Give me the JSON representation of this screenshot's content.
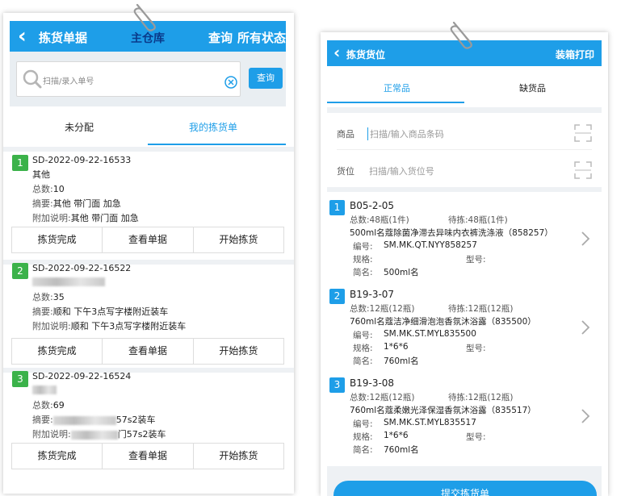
{
  "left": {
    "header": {
      "back": "‹",
      "title": "拣货单据",
      "warehouse": "主仓库",
      "query": "查询",
      "status": "所有状态"
    },
    "search": {
      "placeholder": "扫描/录入单号",
      "button": "查询"
    },
    "tabs": [
      {
        "label": "未分配"
      },
      {
        "label": "我的拣货单"
      }
    ],
    "cards": [
      {
        "index": "1",
        "code": "SD-2022-09-22-16533",
        "line2": "其他",
        "total_label": "总数:",
        "total": "10",
        "summary_label": "摘要:",
        "summary": "其他 带门面  加急",
        "note_label": "附加说明:",
        "note": "其他 带门面  加急",
        "buttons": [
          "拣货完成",
          "查看单据",
          "开始拣货"
        ]
      },
      {
        "index": "2",
        "code": "SD-2022-09-22-16522",
        "line2": "",
        "total_label": "总数:",
        "total": "35",
        "summary_label": "摘要:",
        "summary": "顺和 下午3点写字楼附近装车",
        "note_label": "附加说明:",
        "note": "顺和 下午3点写字楼附近装车",
        "buttons": [
          "拣货完成",
          "查看单据",
          "开始拣货"
        ]
      },
      {
        "index": "3",
        "code": "SD-2022-09-22-16524",
        "line2": "",
        "total_label": "总数:",
        "total": "69",
        "summary_label": "摘要:",
        "summary": "57s2装车",
        "note_label": "附加说明:",
        "note": "门57s2装车",
        "buttons": [
          "拣货完成",
          "查看单据",
          "开始拣货"
        ]
      }
    ]
  },
  "right": {
    "header": {
      "back": "‹",
      "title": "拣货货位",
      "print": "装箱打印"
    },
    "tabs": [
      {
        "label": "正常品"
      },
      {
        "label": "缺货品"
      }
    ],
    "fields": [
      {
        "label": "商品",
        "placeholder": "扫描/输入商品条码"
      },
      {
        "label": "货位",
        "placeholder": "扫描/输入货位号"
      }
    ],
    "items": [
      {
        "index": "1",
        "location": "B05-2-05",
        "total_label": "总数:",
        "total": "48瓶(1件)",
        "pending_label": "待拣:",
        "pending": "48瓶(1件)",
        "product": "500ml名蔻除菌净滞去异味内衣裤洗涤液（858257）",
        "code_label": "编号:",
        "code": "SM.MK.QT.NYY858257",
        "spec_label": "规格:",
        "spec": "",
        "model_label": "型号:",
        "model": "",
        "short_label": "简名:",
        "short": "500ml名"
      },
      {
        "index": "2",
        "location": "B19-3-07",
        "total_label": "总数:",
        "total": "12瓶(12瓶)",
        "pending_label": "待拣:",
        "pending": "12瓶(12瓶)",
        "product": "760ml名蔻洁净细滑泡泡香氛沐浴露（835500）",
        "code_label": "编号:",
        "code": "SM.MK.ST.MYL835500",
        "spec_label": "规格:",
        "spec": "1*6*6",
        "model_label": "型号:",
        "model": "",
        "short_label": "简名:",
        "short": "760ml名"
      },
      {
        "index": "3",
        "location": "B19-3-08",
        "total_label": "总数:",
        "total": "12瓶(12瓶)",
        "pending_label": "待拣:",
        "pending": "12瓶(12瓶)",
        "product": "760ml名蔻柔嫩光泽保湿香氛沐浴露（835517）",
        "code_label": "编号:",
        "code": "SM.MK.ST.MYL835517",
        "spec_label": "规格:",
        "spec": "1*6*6",
        "model_label": "型号:",
        "model": "",
        "short_label": "简名:",
        "short": "760ml名"
      }
    ],
    "submit": "提交拣货单"
  },
  "colors": {
    "accent": "#1e9ee8",
    "badge_green": "#3bb24a",
    "background": "#eef1f4"
  }
}
